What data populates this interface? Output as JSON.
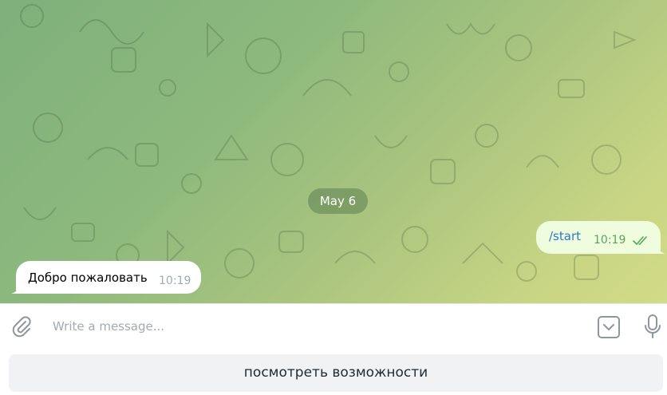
{
  "chat": {
    "date_label": "May 6",
    "messages": [
      {
        "direction": "outgoing",
        "text": "/start",
        "time": "10:19",
        "status": "read"
      },
      {
        "direction": "incoming",
        "text": "Добро пожаловать",
        "time": "10:19"
      }
    ]
  },
  "composer": {
    "placeholder": "Write a message...",
    "value": "",
    "icons": {
      "attach": "paperclip-icon",
      "keyboard": "keyboard-toggle-icon",
      "voice": "microphone-icon"
    }
  },
  "reply_keyboard": {
    "buttons": [
      "посмотреть возможности"
    ]
  },
  "colors": {
    "outgoing_bubble": "#effdde",
    "incoming_bubble": "#ffffff",
    "outgoing_text": "#2b7ac3",
    "outgoing_time": "#5aa35b",
    "incoming_time": "#a0acb6",
    "wallpaper_start": "#7fb07c",
    "wallpaper_end": "#d2db87"
  }
}
